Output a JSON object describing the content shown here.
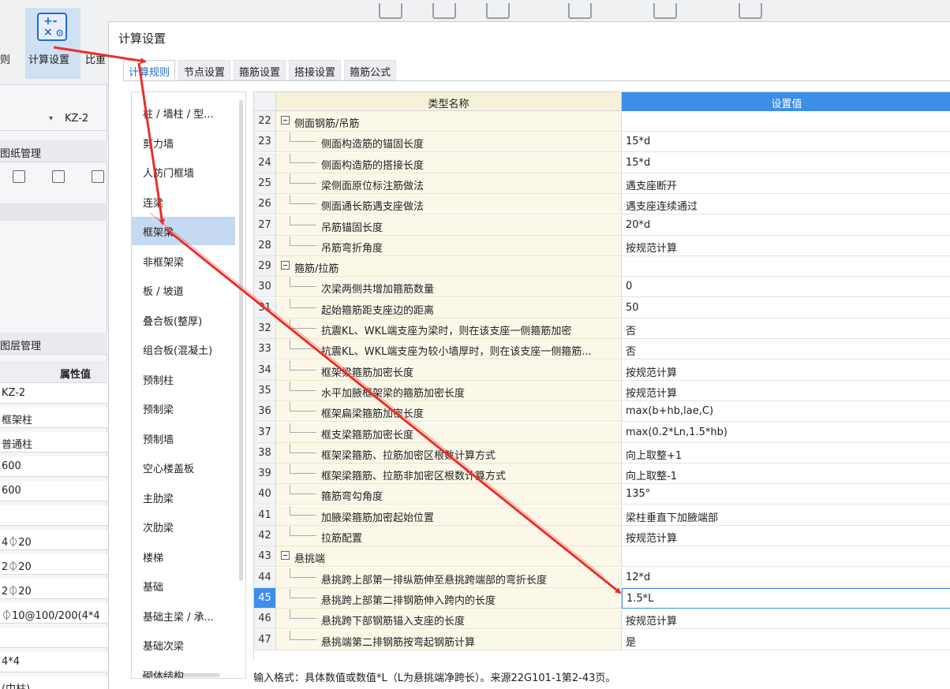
{
  "background_app": {
    "ribbon": {
      "left_char": "则",
      "active_button_label": "计算设置",
      "next_button_label": "比重"
    },
    "side_panel": {
      "dropdown_value": "KZ-2",
      "drawings_header": "图纸管理",
      "layers_header": "图层管理",
      "props_column_header": "属性值",
      "prop_values": [
        "KZ-2",
        "框架柱",
        "普通柱",
        "600",
        "600",
        "",
        "4⏀20",
        "2⏀20",
        "2⏀20",
        "⏀10@100/200(4*4",
        "",
        "4*4",
        "(中柱)"
      ]
    }
  },
  "dialog": {
    "title": "计算设置",
    "tabs": [
      {
        "label": "计算规则",
        "active": true
      },
      {
        "label": "节点设置",
        "active": false
      },
      {
        "label": "箍筋设置",
        "active": false
      },
      {
        "label": "搭接设置",
        "active": false
      },
      {
        "label": "箍筋公式",
        "active": false
      }
    ],
    "categories": [
      {
        "label": "柱 / 墙柱 / 型...",
        "selected": false
      },
      {
        "label": "剪力墙",
        "selected": false
      },
      {
        "label": "人防门框墙",
        "selected": false
      },
      {
        "label": "连梁",
        "selected": false
      },
      {
        "label": "框架梁",
        "selected": true
      },
      {
        "label": "非框架梁",
        "selected": false
      },
      {
        "label": "板 / 坡道",
        "selected": false
      },
      {
        "label": "叠合板(整厚)",
        "selected": false
      },
      {
        "label": "组合板(混凝土)",
        "selected": false
      },
      {
        "label": "预制柱",
        "selected": false
      },
      {
        "label": "预制梁",
        "selected": false
      },
      {
        "label": "预制墙",
        "selected": false
      },
      {
        "label": "空心楼盖板",
        "selected": false
      },
      {
        "label": "主肋梁",
        "selected": false
      },
      {
        "label": "次肋梁",
        "selected": false
      },
      {
        "label": "楼梯",
        "selected": false
      },
      {
        "label": "基础",
        "selected": false
      },
      {
        "label": "基础主梁 / 承...",
        "selected": false
      },
      {
        "label": "基础次梁",
        "selected": false
      },
      {
        "label": "砌体结构",
        "selected": false
      }
    ],
    "grid": {
      "header_name": "类型名称",
      "header_value": "设置值",
      "rows": [
        {
          "num": "22",
          "group": true,
          "name": "侧面钢筋/吊筋",
          "value": ""
        },
        {
          "num": "23",
          "group": false,
          "name": "侧面构造筋的锚固长度",
          "value": "15*d"
        },
        {
          "num": "24",
          "group": false,
          "name": "侧面构造筋的搭接长度",
          "value": "15*d"
        },
        {
          "num": "25",
          "group": false,
          "name": "梁侧面原位标注筋做法",
          "value": "遇支座断开"
        },
        {
          "num": "26",
          "group": false,
          "name": "侧面通长筋遇支座做法",
          "value": "遇支座连续通过"
        },
        {
          "num": "27",
          "group": false,
          "name": "吊筋锚固长度",
          "value": "20*d"
        },
        {
          "num": "28",
          "group": false,
          "name": "吊筋弯折角度",
          "value": "按规范计算"
        },
        {
          "num": "29",
          "group": true,
          "name": "箍筋/拉筋",
          "value": ""
        },
        {
          "num": "30",
          "group": false,
          "name": "次梁两侧共增加箍筋数量",
          "value": "0"
        },
        {
          "num": "31",
          "group": false,
          "name": "起始箍筋距支座边的距离",
          "value": "50"
        },
        {
          "num": "32",
          "group": false,
          "name": "抗震KL、WKL端支座为梁时，则在该支座一侧箍筋加密",
          "value": "否"
        },
        {
          "num": "33",
          "group": false,
          "name": "抗震KL、WKL端支座为较小墙厚时，则在该支座一侧箍筋...",
          "value": "否"
        },
        {
          "num": "34",
          "group": false,
          "name": "框架梁箍筋加密长度",
          "value": "按规范计算"
        },
        {
          "num": "35",
          "group": false,
          "name": "水平加腋框架梁的箍筋加密长度",
          "value": "按规范计算"
        },
        {
          "num": "36",
          "group": false,
          "name": "框架扁梁箍筋加密长度",
          "value": "max(b+hb,lae,C)"
        },
        {
          "num": "37",
          "group": false,
          "name": "框支梁箍筋加密长度",
          "value": "max(0.2*Ln,1.5*hb)"
        },
        {
          "num": "38",
          "group": false,
          "name": "框架梁箍筋、拉筋加密区根数计算方式",
          "value": "向上取整+1"
        },
        {
          "num": "39",
          "group": false,
          "name": "框架梁箍筋、拉筋非加密区根数计算方式",
          "value": "向上取整-1"
        },
        {
          "num": "40",
          "group": false,
          "name": "箍筋弯勾角度",
          "value": "135°"
        },
        {
          "num": "41",
          "group": false,
          "name": "加腋梁箍筋加密起始位置",
          "value": "梁柱垂直下加腋端部"
        },
        {
          "num": "42",
          "group": false,
          "name": "拉筋配置",
          "value": "按规范计算"
        },
        {
          "num": "43",
          "group": true,
          "name": "悬挑端",
          "value": ""
        },
        {
          "num": "44",
          "group": false,
          "name": "悬挑跨上部第一排纵筋伸至悬挑跨端部的弯折长度",
          "value": "12*d"
        },
        {
          "num": "45",
          "group": false,
          "name": "悬挑跨上部第二排钢筋伸入跨内的长度",
          "value": "1.5*L",
          "active": true
        },
        {
          "num": "46",
          "group": false,
          "name": "悬挑跨下部钢筋锚入支座的长度",
          "value": "按规范计算"
        },
        {
          "num": "47",
          "group": false,
          "name": "悬挑端第二排钢筋按弯起钢筋计算",
          "value": "是"
        }
      ]
    },
    "hint": "输入格式：具体数值或数值*L（L为悬挑端净跨长）。来源22G101-1第2-43页。"
  },
  "colors": {
    "accent": "#3d8ee8",
    "arrow": "#e8302a",
    "selected_category": "#c5d9f1",
    "name_column_bg": "#fbf8ea"
  }
}
